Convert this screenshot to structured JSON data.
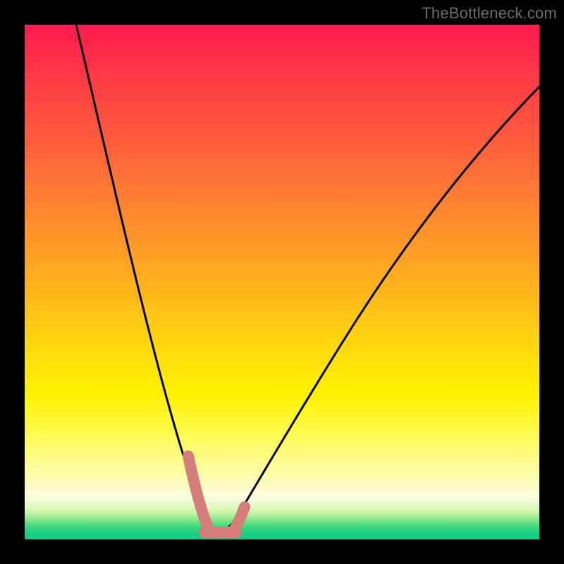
{
  "watermark": "TheBottleneck.com",
  "colors": {
    "frame": "#000000",
    "curve": "#000000",
    "highlight": "#d57d7a",
    "gradient_top": "#ff1a4f",
    "gradient_bottom": "#14cc88"
  },
  "chart_data": {
    "type": "line",
    "title": "",
    "xlabel": "",
    "ylabel": "",
    "xlim": [
      0,
      100
    ],
    "ylim": [
      0,
      100
    ],
    "grid": false,
    "legend": false,
    "annotations": [],
    "series": [
      {
        "name": "bottleneck-curve",
        "x": [
          10,
          12,
          14,
          16,
          18,
          20,
          22,
          24,
          26,
          28,
          30,
          31,
          32,
          33,
          34,
          35,
          36,
          37,
          38,
          40,
          42,
          45,
          48,
          52,
          56,
          60,
          65,
          70,
          75,
          80,
          85,
          90,
          95,
          100
        ],
        "y": [
          100,
          90,
          80,
          70,
          61,
          52,
          44,
          36,
          28,
          21,
          14,
          11,
          8,
          6,
          4,
          3,
          2,
          2,
          3,
          5,
          8,
          13,
          18,
          25,
          32,
          38,
          46,
          53,
          60,
          66,
          72,
          78,
          83,
          88
        ]
      },
      {
        "name": "highlight-segment",
        "x": [
          29,
          30,
          31,
          32,
          33,
          34,
          35,
          36,
          37,
          38,
          39
        ],
        "y": [
          18,
          14,
          11,
          8,
          6,
          4,
          3,
          2,
          2,
          3,
          4
        ]
      }
    ]
  }
}
